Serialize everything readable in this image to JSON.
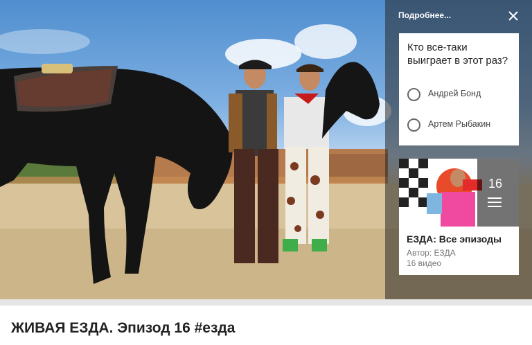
{
  "player": {
    "more_link": "Подробнее...",
    "close_icon": "close-icon",
    "poll": {
      "question": "Кто все-таки выиграет в этот раз?",
      "options": [
        {
          "label": "Андрей Бонд"
        },
        {
          "label": "Артем Рыбакин"
        }
      ]
    },
    "playlist": {
      "count_badge": "16",
      "list_icon": "playlist-icon",
      "title": "ЕЗДА: Все эпизоды",
      "author": "Автор: ЕЗДА",
      "video_count": "16 видео"
    }
  },
  "video": {
    "title": "ЖИВАЯ ЕЗДА. Эпизод 16 #езда"
  },
  "colors": {
    "panel_overlay": "#282828",
    "card_bg": "#ffffff",
    "text_primary": "#222222",
    "text_secondary": "#777777"
  }
}
